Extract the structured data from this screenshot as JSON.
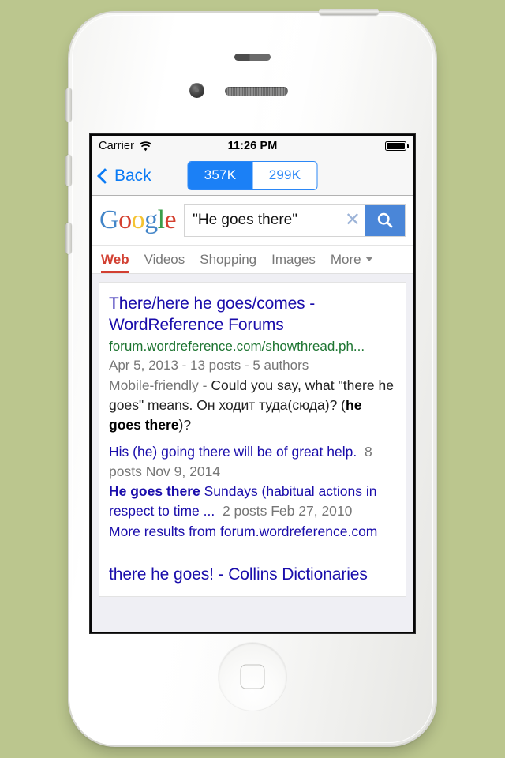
{
  "device": {
    "frame": "iphone-white",
    "background_color": "#bbc68e"
  },
  "status_bar": {
    "carrier": "Carrier",
    "wifi_icon": "wifi-icon",
    "time": "11:26 PM",
    "battery_icon": "battery-full-icon"
  },
  "nav_bar": {
    "back_label": "Back",
    "back_icon": "chevron-left-icon",
    "segments": [
      {
        "label": "357K",
        "selected": true
      },
      {
        "label": "299K",
        "selected": false
      }
    ],
    "tint_color": "#1b80f6"
  },
  "google_header": {
    "logo": {
      "name": "google-logo",
      "letters": [
        "G",
        "o",
        "o",
        "g",
        "l",
        "e"
      ],
      "colors": [
        "#4285c8",
        "#d4402f",
        "#f5c332",
        "#4285c8",
        "#3a9e4a",
        "#d4402f"
      ]
    },
    "search": {
      "value": "\"He goes there\"",
      "placeholder": "Search",
      "clear_icon": "clear-x-icon",
      "search_icon": "search-icon",
      "button_color": "#4a86d8"
    },
    "tabs": [
      {
        "label": "Web",
        "active": true
      },
      {
        "label": "Videos",
        "active": false
      },
      {
        "label": "Shopping",
        "active": false
      },
      {
        "label": "Images",
        "active": false
      },
      {
        "label": "More",
        "active": false,
        "has_caret": true
      }
    ],
    "active_tab_color": "#d23f31"
  },
  "results": [
    {
      "title": "There/here he goes/comes - WordReference Forums",
      "url": "forum.wordreference.com/showthread.ph...",
      "meta": "Apr 5, 2013 - 13 posts - 5 authors",
      "snippet_prefix": "Mobile-friendly",
      "snippet_dash": " - ",
      "snippet_parts": [
        {
          "text": "Could you say, what \"there he goes\" means. Он ходит туда(сюда)? (",
          "bold": false
        },
        {
          "text": "he goes there",
          "bold": true
        },
        {
          "text": ")?",
          "bold": false
        }
      ],
      "sitelinks": [
        {
          "title_plain": "",
          "title_bold": "",
          "title": "His (he) going there will be of great help.",
          "meta": "8 posts  Nov 9, 2014"
        },
        {
          "title_bold": "He goes there",
          "title_rest": " Sundays (habitual actions in respect to time ...",
          "meta": "2 posts  Feb 27, 2010"
        }
      ],
      "more_results": "More results from forum.wordreference.com"
    },
    {
      "title": "there he goes! - Collins Dictionaries"
    }
  ]
}
